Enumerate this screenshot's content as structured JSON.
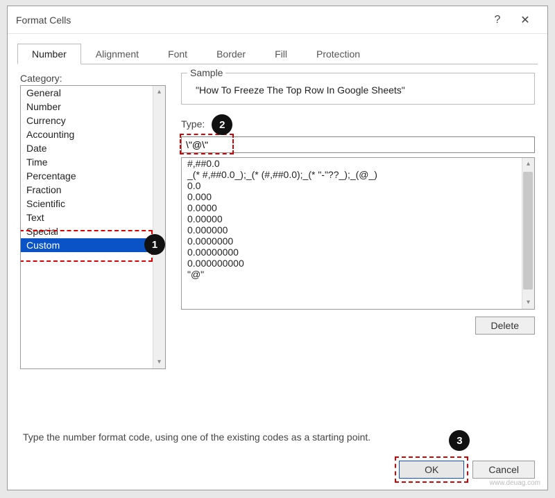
{
  "titlebar": {
    "title": "Format Cells",
    "help": "?",
    "close": "✕"
  },
  "tabs": [
    "Number",
    "Alignment",
    "Font",
    "Border",
    "Fill",
    "Protection"
  ],
  "activeTab": 0,
  "category": {
    "label": "Category:",
    "items": [
      "General",
      "Number",
      "Currency",
      "Accounting",
      "Date",
      "Time",
      "Percentage",
      "Fraction",
      "Scientific",
      "Text",
      "Special",
      "Custom"
    ],
    "selectedIndex": 11
  },
  "sample": {
    "legend": "Sample",
    "text": "\"How To Freeze The Top Row In Google Sheets\""
  },
  "type": {
    "label": "Type:",
    "value": "\\\"@\\\"",
    "formats": [
      "#,##0.0",
      "_(* #,##0.0_);_(* (#,##0.0);_(* \"-\"??_);_(@_)",
      "0.0",
      "0.000",
      "0.0000",
      "0.00000",
      "0.000000",
      "0.0000000",
      "0.00000000",
      "0.000000000",
      "\"@\""
    ]
  },
  "deleteLabel": "Delete",
  "description": "Type the number format code, using one of the existing codes as a starting point.",
  "footer": {
    "ok": "OK",
    "cancel": "Cancel"
  },
  "callouts": {
    "one": "1",
    "two": "2",
    "three": "3"
  },
  "watermark": "www.deuag.com"
}
